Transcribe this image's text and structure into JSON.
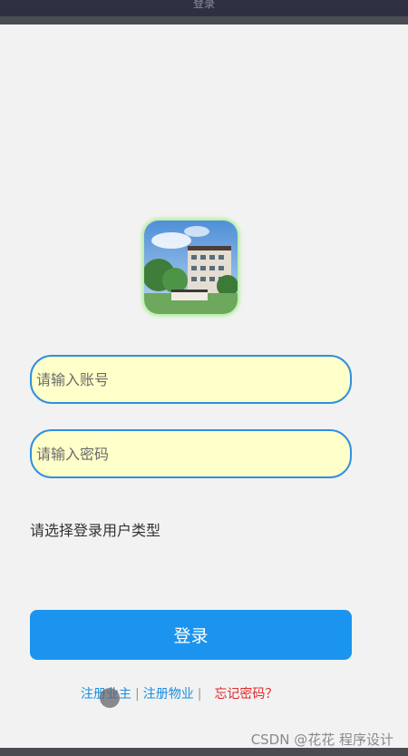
{
  "window": {
    "title": "登录"
  },
  "form": {
    "account_placeholder": "请输入账号",
    "password_placeholder": "请输入密码",
    "user_type_prompt": "请选择登录用户类型",
    "login_label": "登录"
  },
  "links": {
    "register_owner": "注册业主",
    "separator": "|",
    "register_property": "注册物业",
    "forgot_password": "忘记密码？"
  },
  "watermark": "CSDN @花花 程序设计",
  "icons": {
    "logo": "building-logo-icon"
  }
}
